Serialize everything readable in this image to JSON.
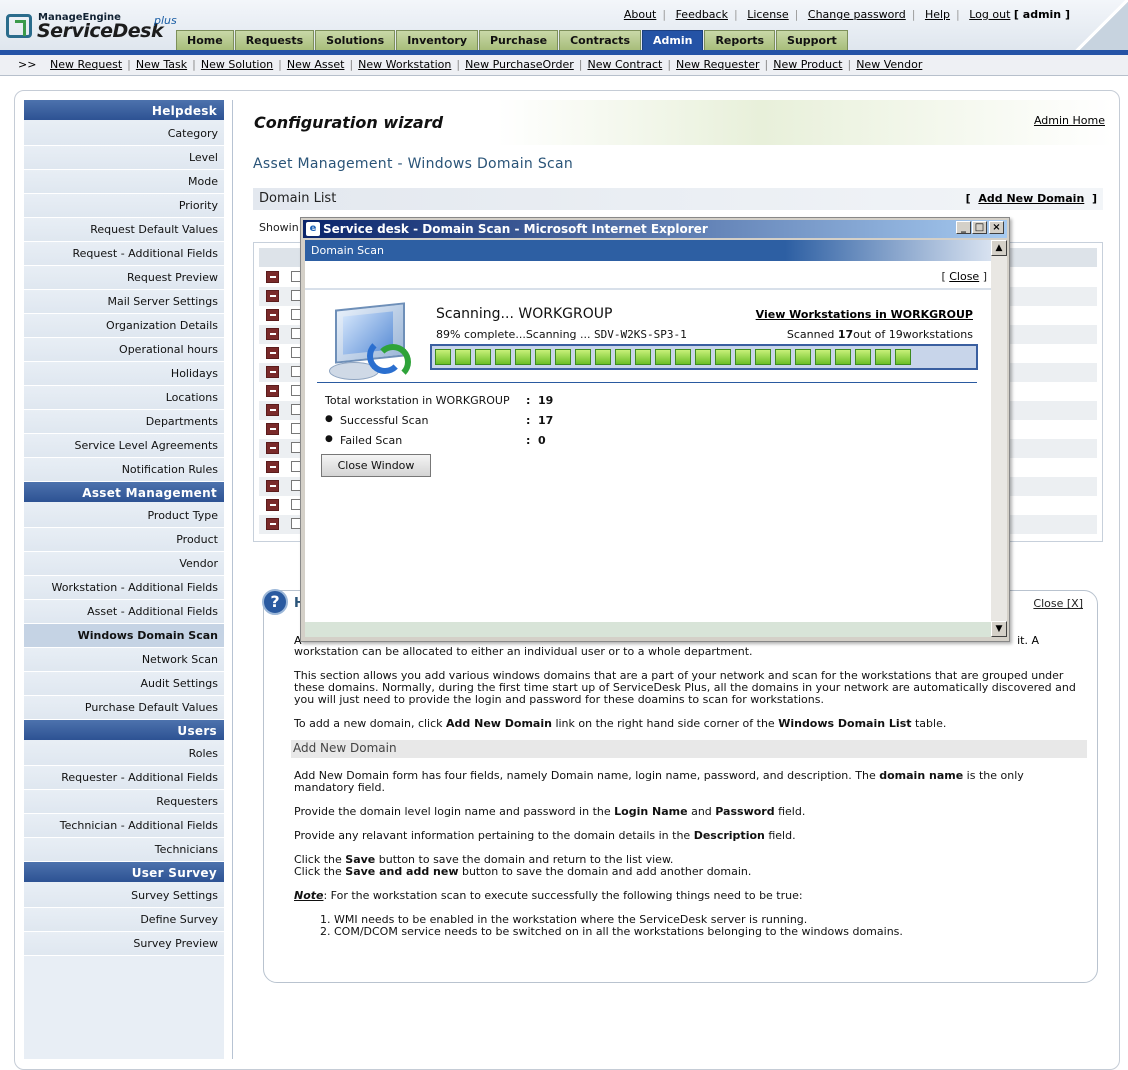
{
  "brand": {
    "vendor": "ManageEngine",
    "product": "ServiceDesk",
    "edition": "plus"
  },
  "toplinks": {
    "about": "About",
    "feedback": "Feedback",
    "license": "License",
    "change_password": "Change password",
    "help": "Help",
    "logout": "Log out",
    "user": "[ admin ]"
  },
  "tabs": [
    {
      "label": "Home"
    },
    {
      "label": "Requests"
    },
    {
      "label": "Solutions"
    },
    {
      "label": "Inventory"
    },
    {
      "label": "Purchase"
    },
    {
      "label": "Contracts"
    },
    {
      "label": "Admin"
    },
    {
      "label": "Reports"
    },
    {
      "label": "Support"
    }
  ],
  "quickbar": {
    "arrows": ">>",
    "links": [
      {
        "label": "New Request"
      },
      {
        "label": "New Task"
      },
      {
        "label": "New Solution"
      },
      {
        "label": "New Asset"
      },
      {
        "label": "New Workstation"
      },
      {
        "label": "New PurchaseOrder"
      },
      {
        "label": "New Contract"
      },
      {
        "label": "New Requester"
      },
      {
        "label": "New Product"
      },
      {
        "label": "New Vendor"
      }
    ]
  },
  "sidebar": {
    "helpdesk": {
      "title": "Helpdesk",
      "items": [
        "Category",
        "Level",
        "Mode",
        "Priority",
        "Request Default Values",
        "Request - Additional Fields",
        "Request Preview",
        "Mail Server Settings",
        "Organization Details",
        "Operational hours",
        "Holidays",
        "Locations",
        "Departments",
        "Service Level Agreements",
        "Notification Rules"
      ]
    },
    "asset": {
      "title": "Asset Management",
      "items": [
        "Product Type",
        "Product",
        "Vendor",
        "Workstation - Additional Fields",
        "Asset - Additional Fields",
        "Windows Domain Scan",
        "Network Scan",
        "Audit Settings",
        "Purchase Default Values"
      ]
    },
    "users": {
      "title": "Users",
      "items": [
        "Roles",
        "Requester - Additional Fields",
        "Requesters",
        "Technician - Additional Fields",
        "Technicians"
      ]
    },
    "survey": {
      "title": "User Survey",
      "items": [
        "Survey Settings",
        "Define Survey",
        "Survey Preview"
      ]
    }
  },
  "main": {
    "title": "Configuration wizard",
    "admin_home": "Admin Home",
    "section_title": "Asset Management - Windows Domain Scan",
    "domain_list": {
      "title": "Domain List",
      "bracket_open": "[",
      "add_new": "Add New Domain",
      "bracket_close": "]",
      "showing": "Showin"
    }
  },
  "help": {
    "icon": "?",
    "header_initial": "H",
    "close": "Close [X]",
    "line1_start": "A",
    "line1_end": "it. A",
    "p1": "workstation can be allocated to either an individual user or to a whole department.",
    "p2": "This section allows you add various windows domains that are a part of your network and scan for the workstations that are grouped under these domains. Normally, during the first time start up of ServiceDesk Plus, all the domains in your network are automatically discovered and you will just need to provide the login and password for these doamins to scan for workstations.",
    "p3a": "To add a new domain, click ",
    "p3b": "Add New Domain",
    "p3c": " link on the right hand side corner of the ",
    "p3d": "Windows Domain List",
    "p3e": " table.",
    "subhead": "Add New Domain",
    "p4a": "Add New Domain form has four fields, namely Domain name, login name, password, and description. The ",
    "p4b": "domain name",
    "p4c": " is the only mandatory field.",
    "p5a": "Provide the domain level login name and password in the ",
    "p5b": "Login Name",
    "p5c": " and ",
    "p5d": "Password",
    "p5e": " field.",
    "p6a": "Provide any relavant information pertaining to the domain details in the ",
    "p6b": "Description",
    "p6c": " field.",
    "p7a": "Click the ",
    "p7b": "Save",
    "p7c": " button to save the domain and return to the list view.",
    "p8a": "Click the ",
    "p8b": "Save and add new",
    "p8c": " button to save the domain and add another domain.",
    "note_label": "Note",
    "note_text": ": For the workstation scan to execute successfully the following things need to be true:",
    "list": [
      "WMI needs to be enabled in the workstation where the ServiceDesk server is running.",
      "COM/DCOM service needs to be switched on in all the workstations belonging to the windows domains."
    ]
  },
  "popup": {
    "window_title": "Service desk - Domain Scan - Microsoft Internet Explorer",
    "ie_glyph": "e",
    "btn_min": "_",
    "btn_max": "□",
    "btn_close": "×",
    "header": "Domain Scan",
    "close_link_open": "[ ",
    "close_link": "Close",
    "close_link_close": " ]",
    "scanning": "Scanning... WORKGROUP",
    "view_link": "View Workstations in WORKGROUP",
    "percent_text": "89% complete...Scanning ... ",
    "host": "SDV-W2KS-SP3-1",
    "scanned_pre": "Scanned ",
    "scanned_count": "17",
    "scanned_mid": "out of ",
    "scanned_total": "19",
    "scanned_post": "workstations",
    "progress": 0.89,
    "progress_segments_total": 27,
    "stats": [
      {
        "label": "Total workstation in WORKGROUP",
        "value": "19",
        "bullet": false
      },
      {
        "label": "Successful Scan",
        "value": "17",
        "bullet": true
      },
      {
        "label": "Failed Scan",
        "value": "0",
        "bullet": true
      }
    ],
    "colon": ":",
    "bullet": "●",
    "close_window": "Close Window",
    "scroll_up": "▲",
    "scroll_down": "▼"
  }
}
